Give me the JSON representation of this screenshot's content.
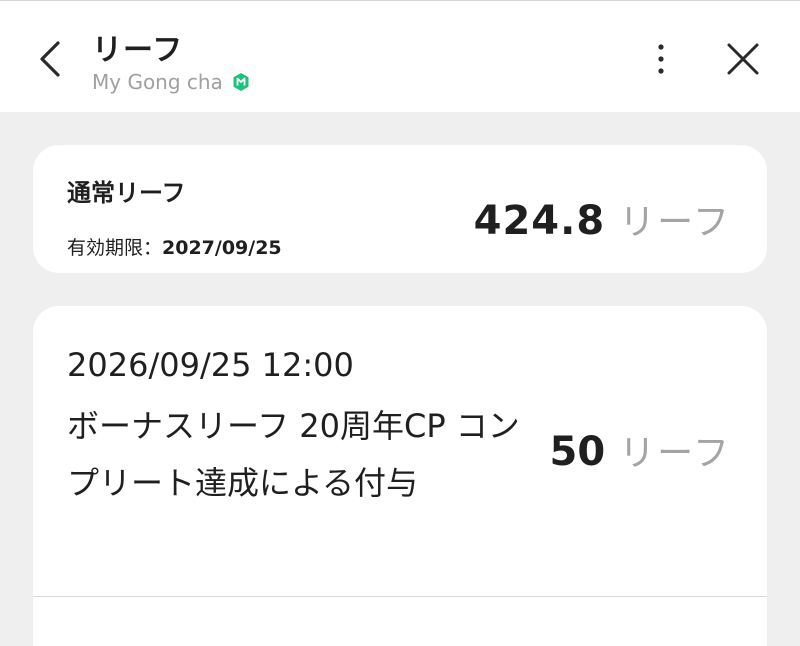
{
  "header": {
    "title": "リーフ",
    "subtitle": "My Gong cha",
    "verified_color": "#19c37d",
    "icons": {
      "back": "chevron-left-icon",
      "more": "more-vertical-icon",
      "close": "close-icon",
      "verified": "verified-badge-icon"
    }
  },
  "balance": {
    "label": "通常リーフ",
    "expiry_label": "有効期限：",
    "expiry_date": "2027/09/25",
    "value": "424.8",
    "unit": "リーフ"
  },
  "history": [
    {
      "datetime": "2026/09/25 12:00",
      "description": "ボーナスリーフ 20周年CP コンプリート達成による付与",
      "value": "50",
      "unit": "リーフ"
    }
  ]
}
